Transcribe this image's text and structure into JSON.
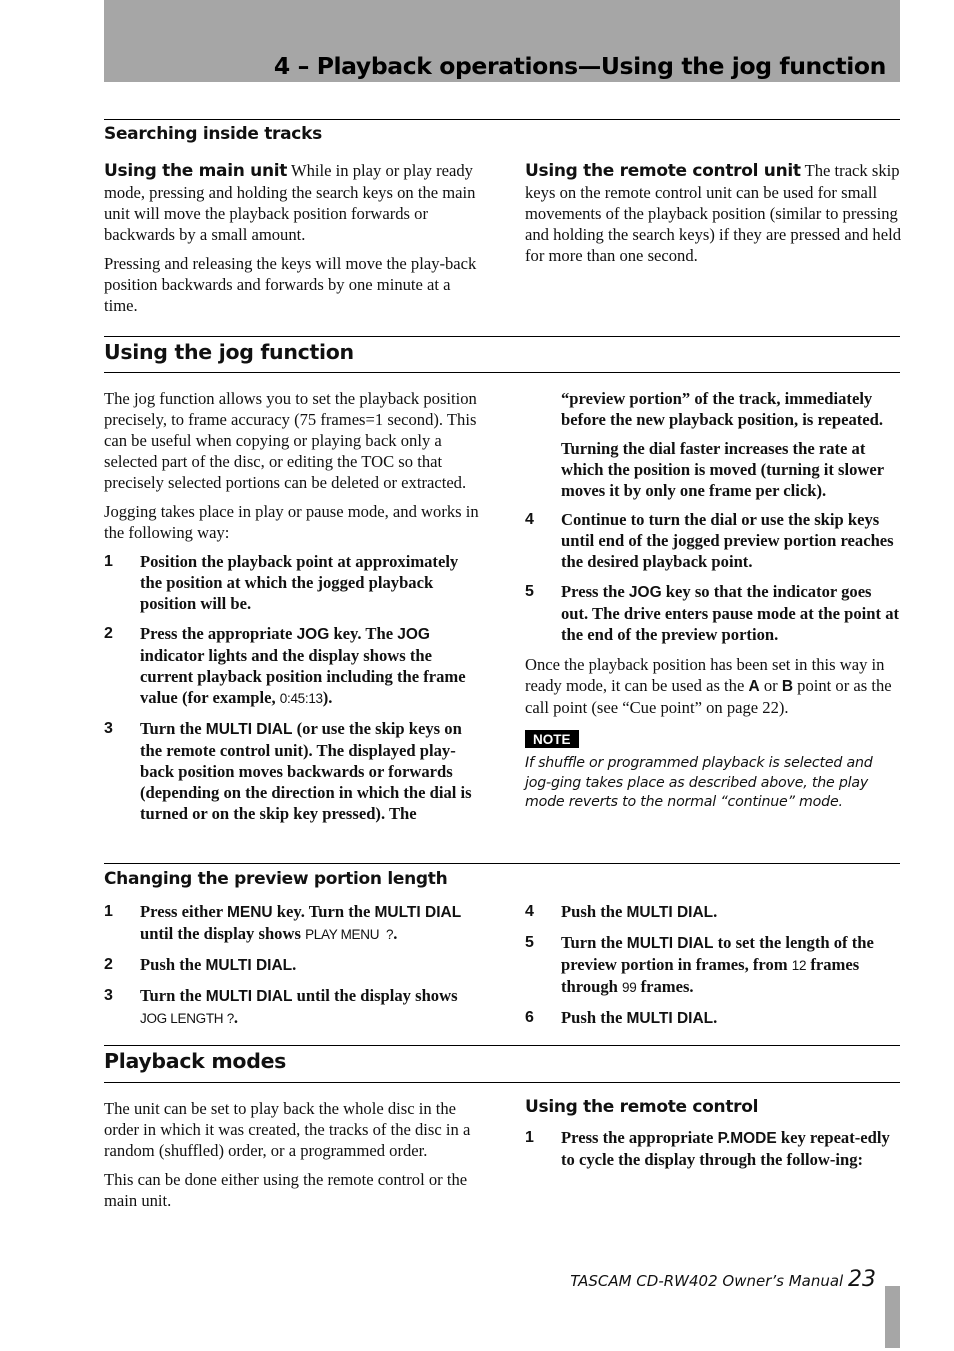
{
  "header": {
    "chapter_title": "4 – Playback operations—Using the jog function"
  },
  "searching": {
    "title": "Searching inside tracks",
    "main_unit": {
      "runin": "Using the main unit",
      "p1": " While in play or play ready mode, pressing and holding the search keys on the main unit will move the playback position forwards or backwards by a small amount.",
      "p2": "Pressing and releasing the keys will move the play-back position backwards and forwards by one minute at a time."
    },
    "remote_unit": {
      "runin": "Using the remote control unit",
      "p1": " The track skip keys on the remote control unit can be used for small movements of the playback position (similar to pressing and holding the search keys) if they are pressed and held for more than one second."
    }
  },
  "jog": {
    "title": "Using the jog function",
    "intro1": "The jog function allows you to set the playback position precisely, to frame accuracy (75 frames=1 second). This can be useful when copying or playing back only a selected part of the disc, or editing the TOC so that precisely selected portions can be deleted or extracted.",
    "intro2": "Jogging takes place in play or pause mode, and works in the following way:",
    "step1": {
      "num": "1",
      "text": "Position the playback point at approximately the position at which the jogged playback position will be."
    },
    "step2": {
      "num": "2",
      "t1": "Press the appropriate ",
      "k1": "JOG",
      "t2": " key. The ",
      "k2": "JOG",
      "t3": " indicator lights and the display shows the current playback position including the frame value (for example, ",
      "lcd": "0:45:13",
      "t4": ")."
    },
    "step3": {
      "num": "3",
      "t1": "Turn the ",
      "k1": "MULTI DIAL",
      "t2": " (or use the skip keys on the remote control unit). The displayed play-back position moves backwards or forwards (depending on the direction in which the dial is turned or on the skip key pressed). The"
    },
    "step3_cont": "“preview portion” of the track, immediately before the new playback position, is repeated.",
    "step3_extra": "Turning the dial faster increases the rate at which the position is moved (turning it slower moves it by only one frame per click).",
    "step4": {
      "num": "4",
      "text": "Continue to turn the dial or use the skip keys until end of the jogged preview portion reaches the desired playback point."
    },
    "step5": {
      "num": "5",
      "t1": "Press the ",
      "k1": "JOG",
      "t2": " key so that the indicator goes out. The drive enters pause mode at the point at the end of the preview portion."
    },
    "after": {
      "t1": "Once the playback position has been set in this way in ready mode, it can be used as the ",
      "k1": "A",
      "t2": " or ",
      "k2": "B",
      "t3": " point or as the call point (see “Cue point” on page 22)."
    },
    "note_label": "NOTE",
    "note_text": "If shuffle or programmed playback is selected and jog-ging takes place as described above, the play mode reverts to the normal “continue” mode."
  },
  "preview": {
    "title": "Changing the preview portion length",
    "step1": {
      "num": "1",
      "t1": "Press either ",
      "k1": "MENU",
      "t2": " key. Turn the ",
      "k2": "MULTI DIAL",
      "t3": " until the display shows ",
      "lcd": "PLAY MENU  ?",
      "t4": "."
    },
    "step2": {
      "num": "2",
      "t1": "Push the ",
      "k1": "MULTI DIAL",
      "t2": "."
    },
    "step3": {
      "num": "3",
      "t1": "Turn the ",
      "k1": "MULTI DIAL",
      "t2": " until the display shows ",
      "lcd": "JOG LENGTH ?",
      "t3": "."
    },
    "step4": {
      "num": "4",
      "t1": "Push the ",
      "k1": "MULTI DIAL",
      "t2": "."
    },
    "step5": {
      "num": "5",
      "t1": "Turn the ",
      "k1": "MULTI DIAL",
      "t2": " to set the length of the preview portion in frames, from ",
      "lcd1": "12",
      "t3": " frames through ",
      "lcd2": "99",
      "t4": " frames."
    },
    "step6": {
      "num": "6",
      "t1": "Push the ",
      "k1": "MULTI DIAL",
      "t2": "."
    }
  },
  "modes": {
    "title": "Playback modes",
    "p1": "The unit can be set to play back the whole disc in the order in which it was created, the tracks of the disc in a random (shuffled) order, or a programmed order.",
    "p2": "This can be done either using the remote control or the main unit.",
    "remote_title": "Using the remote control",
    "step1": {
      "num": "1",
      "t1": "Press the appropriate ",
      "k1": "P.MODE",
      "t2": " key repeat-edly to cycle the display through the follow-ing:"
    }
  },
  "footer": {
    "manual": "TASCAM CD-RW402 Owner’s Manual ",
    "page": "23"
  }
}
